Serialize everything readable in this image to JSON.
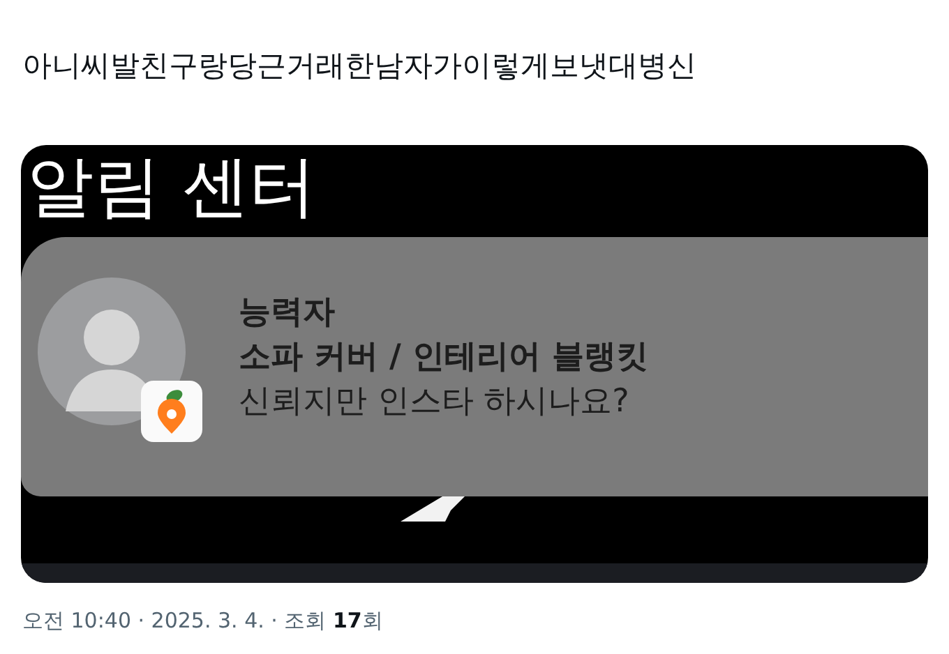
{
  "post": {
    "text": "아니씨발친구랑당근거래한남자가이렇게보냇대병신"
  },
  "screenshot": {
    "heading": "알림 센터",
    "notification": {
      "sender": "능력자",
      "title": "소파 커버 / 인테리어 블랭킷",
      "message": "신뢰지만 인스타 하시나요?"
    }
  },
  "meta": "오전 10:40 · 2025. 3. 4. · 조회 **17**회"
}
